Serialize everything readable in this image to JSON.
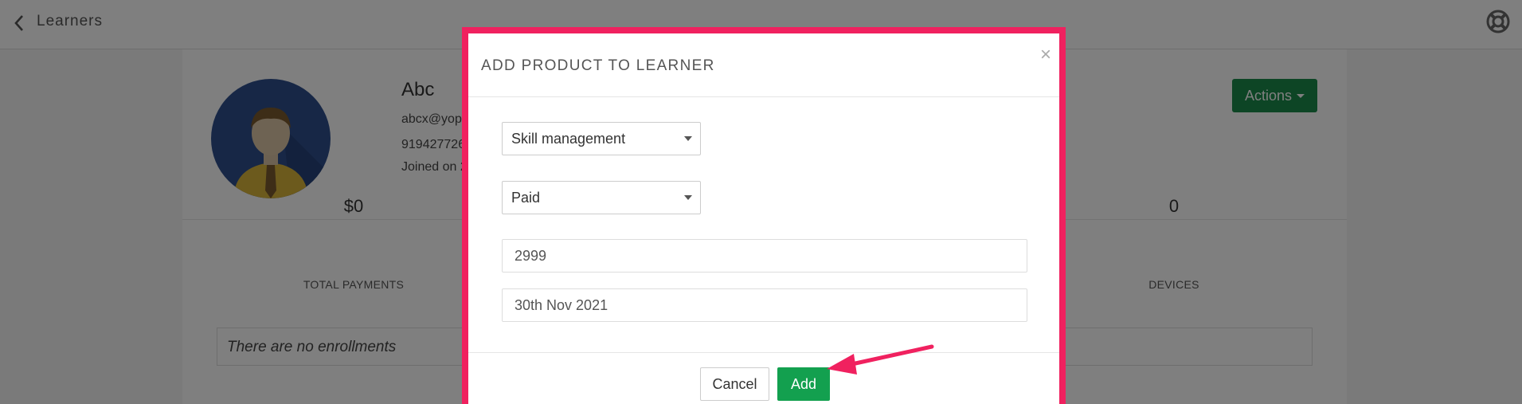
{
  "topbar": {
    "back_label": "Learners"
  },
  "profile": {
    "name": "Abc",
    "email": "abcx@yopr",
    "phone": "919427726",
    "joined": "Joined on 2",
    "actions_label": "Actions"
  },
  "stats": [
    {
      "value": "$0",
      "label": "TOTAL PAYMENTS"
    },
    {
      "value": "0",
      "label": "DEVICES"
    }
  ],
  "enrollments": {
    "empty_text": "There are no enrollments"
  },
  "modal": {
    "title": "ADD PRODUCT TO LEARNER",
    "close_symbol": "×",
    "product_select": "Skill management",
    "pricing_select": "Paid",
    "price_value": "2999",
    "date_value": "30th Nov 2021",
    "cancel_label": "Cancel",
    "add_label": "Add"
  },
  "colors": {
    "highlight_border": "#f0215f",
    "primary_green": "#13a04f",
    "actions_green": "#1a8a4b",
    "avatar_bg": "#2f4f8c"
  },
  "icons": [
    "chevron-left-icon",
    "lifebuoy-icon",
    "chevron-down-icon",
    "close-icon",
    "pointer-arrow-icon"
  ]
}
